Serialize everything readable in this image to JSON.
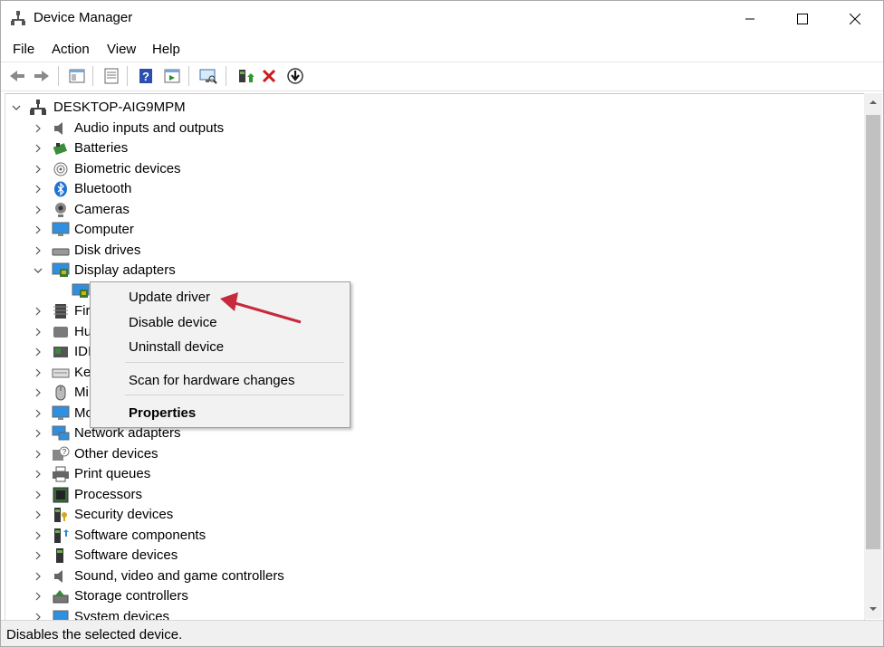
{
  "window": {
    "title": "Device Manager"
  },
  "menubar": {
    "items": [
      "File",
      "Action",
      "View",
      "Help"
    ]
  },
  "toolbar": {
    "buttons": [
      "back-icon",
      "forward-icon",
      "properties-icon",
      "list-icon",
      "help-icon",
      "action-icon",
      "scan-monitor-icon",
      "update-driver-icon",
      "uninstall-icon",
      "disable-icon"
    ]
  },
  "tree": {
    "root": "DESKTOP-AIG9MPM",
    "categories": [
      "Audio inputs and outputs",
      "Batteries",
      "Biometric devices",
      "Bluetooth",
      "Cameras",
      "Computer",
      "Disk drives",
      "Display adapters",
      "Firmware",
      "Human Interface Devices",
      "IDE ATA/ATAPI controllers",
      "Keyboards",
      "Mice and other pointing devices",
      "Monitors",
      "Network adapters",
      "Other devices",
      "Print queues",
      "Processors",
      "Security devices",
      "Software components",
      "Software devices",
      "Sound, video and game controllers",
      "Storage controllers",
      "System devices"
    ],
    "truncated_visible": [
      "Fir",
      "Hu",
      "IDI",
      "Ke",
      "Mi",
      "Mo"
    ]
  },
  "context_menu": {
    "update": "Update driver",
    "disable": "Disable device",
    "uninstall": "Uninstall device",
    "scan": "Scan for hardware changes",
    "properties": "Properties"
  },
  "status": {
    "text": "Disables the selected device."
  },
  "colors": {
    "accent": "#1e73d2",
    "arrow": "#c62a3c"
  }
}
